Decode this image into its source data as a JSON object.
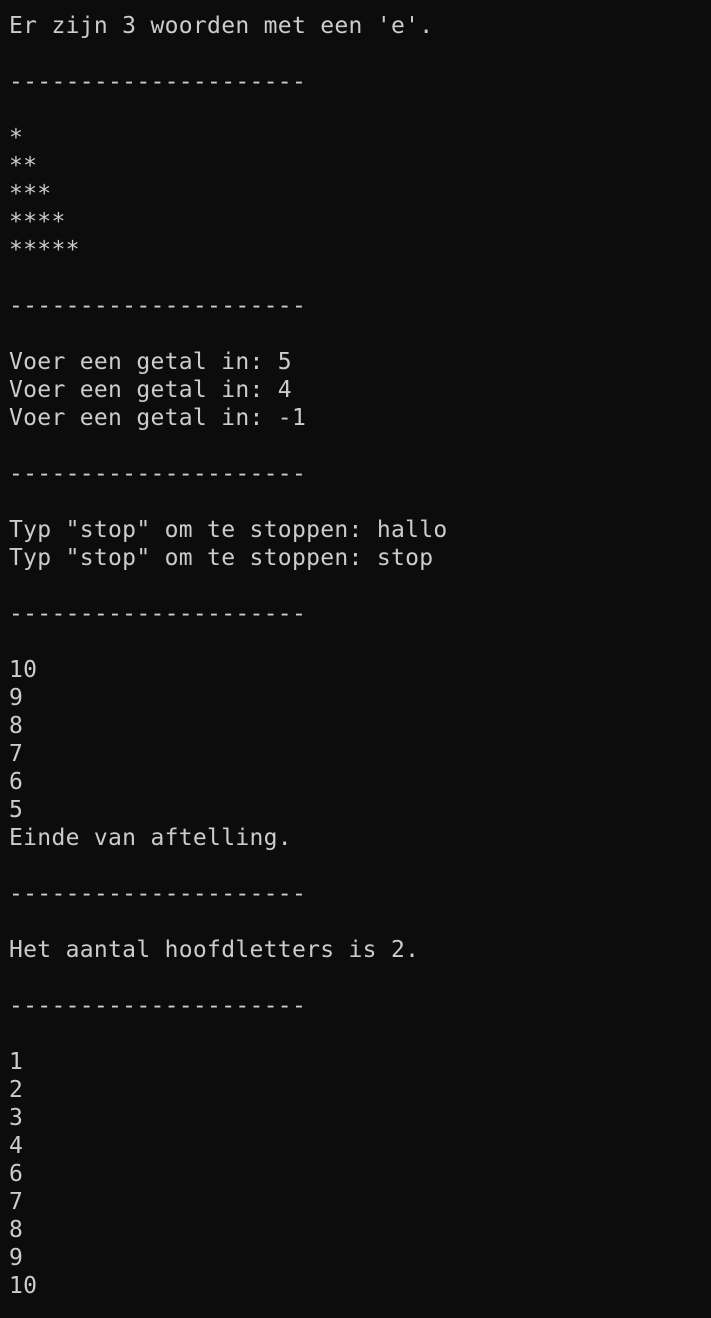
{
  "terminal": {
    "lines": [
      "Er zijn 3 woorden met een 'e'.",
      "",
      "---------------------",
      "",
      "*",
      "**",
      "***",
      "****",
      "*****",
      "",
      "---------------------",
      "",
      "Voer een getal in: 5",
      "Voer een getal in: 4",
      "Voer een getal in: -1",
      "",
      "---------------------",
      "",
      "Typ \"stop\" om te stoppen: hallo",
      "Typ \"stop\" om te stoppen: stop",
      "",
      "---------------------",
      "",
      "10",
      "9",
      "8",
      "7",
      "6",
      "5",
      "Einde van aftelling.",
      "",
      "---------------------",
      "",
      "Het aantal hoofdletters is 2.",
      "",
      "---------------------",
      "",
      "1",
      "2",
      "3",
      "4",
      "6",
      "7",
      "8",
      "9",
      "10"
    ]
  }
}
